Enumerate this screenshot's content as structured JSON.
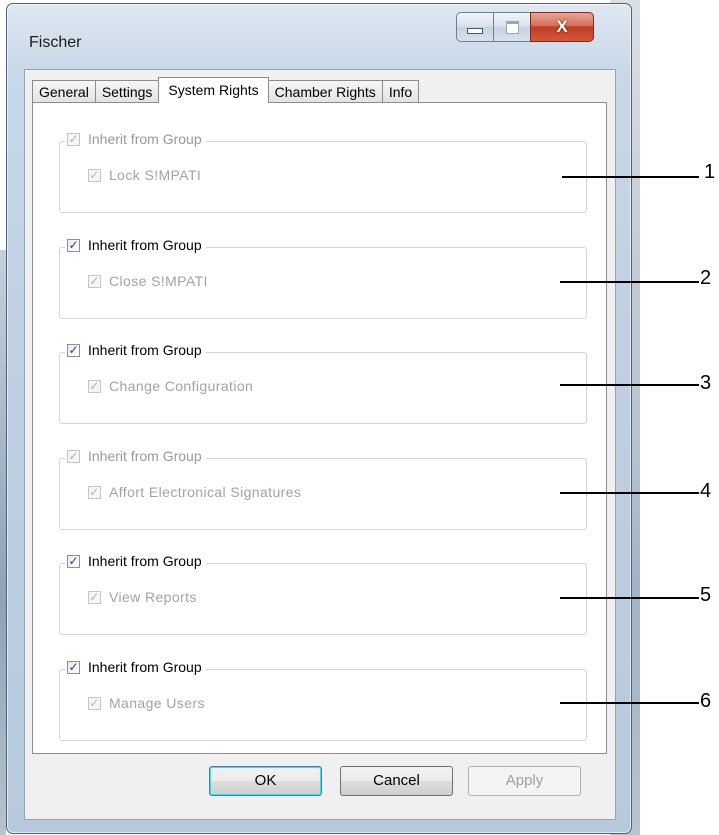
{
  "window": {
    "title": "Fischer",
    "close_glyph": "X"
  },
  "tabs": [
    {
      "label": "General"
    },
    {
      "label": "Settings"
    },
    {
      "label": "System Rights"
    },
    {
      "label": "Chamber Rights"
    },
    {
      "label": "Info"
    }
  ],
  "active_tab": "System Rights",
  "groups": [
    {
      "header": "Inherit from Group",
      "header_checked": true,
      "header_enabled": false,
      "child": "Lock S!MPATI",
      "child_checked": true,
      "child_enabled": false
    },
    {
      "header": "Inherit from Group",
      "header_checked": true,
      "header_enabled": true,
      "child": "Close S!MPATI",
      "child_checked": true,
      "child_enabled": false
    },
    {
      "header": "Inherit from Group",
      "header_checked": true,
      "header_enabled": true,
      "child": "Change Configuration",
      "child_checked": true,
      "child_enabled": false
    },
    {
      "header": "Inherit from Group",
      "header_checked": true,
      "header_enabled": false,
      "child": "Affort Electronical Signatures",
      "child_checked": true,
      "child_enabled": false
    },
    {
      "header": "Inherit from Group",
      "header_checked": true,
      "header_enabled": true,
      "child": "View Reports",
      "child_checked": true,
      "child_enabled": false
    },
    {
      "header": "Inherit from Group",
      "header_checked": true,
      "header_enabled": true,
      "child": "Manage Users",
      "child_checked": true,
      "child_enabled": false
    }
  ],
  "buttons": {
    "ok": "OK",
    "cancel": "Cancel",
    "apply": "Apply",
    "apply_enabled": false
  },
  "callouts": [
    "1",
    "2",
    "3",
    "4",
    "5",
    "6"
  ],
  "icons": [
    "minimize-icon",
    "maximize-icon",
    "close-icon",
    "checkbox-checked-icon"
  ],
  "colors": {
    "check": "#1f3f9a",
    "disabled_text": "#9a9a9a",
    "close_button": "#c03d22"
  }
}
